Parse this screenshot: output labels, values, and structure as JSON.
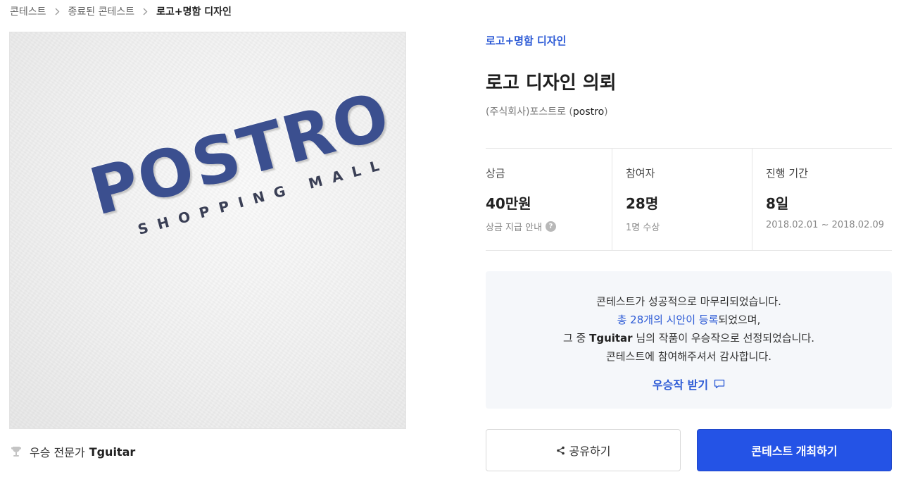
{
  "breadcrumb": {
    "items": [
      "콘테스트",
      "종료된 콘테스트",
      "로고+명함 디자인"
    ]
  },
  "hero": {
    "wordmark": "POSTRO",
    "tagline": "SHOPPING MALL",
    "brand_color": "#3b4f8f"
  },
  "winner": {
    "label": "우승 전문가",
    "name": "Tguitar",
    "icon": "trophy-icon"
  },
  "contest": {
    "category": "로고+명함 디자인",
    "title": "로고 디자인 의뢰",
    "company_prefix": "(주식회사)포스트로 (",
    "company_handle": "postro",
    "company_suffix": ")"
  },
  "stats": {
    "prize": {
      "label": "상금",
      "value": "40만원",
      "sub": "상금 지급 안내",
      "help_icon": "?"
    },
    "participants": {
      "label": "참여자",
      "value": "28명",
      "sub": "1명 수상"
    },
    "period": {
      "label": "진행 기간",
      "value": "8일",
      "sub": "2018.02.01 ~ 2018.02.09"
    }
  },
  "notice": {
    "line1": "콘테스트가 성공적으로 마무리되었습니다.",
    "line2_link": "총 28개의 시안이 등록",
    "line2_rest": "되었으며,",
    "line3_prefix": "그 중 ",
    "line3_name": "Tguitar",
    "line3_rest": " 님의 작품이 우승작으로 선정되었습니다.",
    "line4": "콘테스트에 참여해주셔서 감사합니다.",
    "receive_label": "우승작 받기"
  },
  "actions": {
    "share_label": "공유하기",
    "host_label": "콘테스트 개최하기"
  },
  "colors": {
    "accent": "#2d5bd6",
    "primary_button": "#2453e6",
    "notice_bg": "#f5f7fa"
  }
}
